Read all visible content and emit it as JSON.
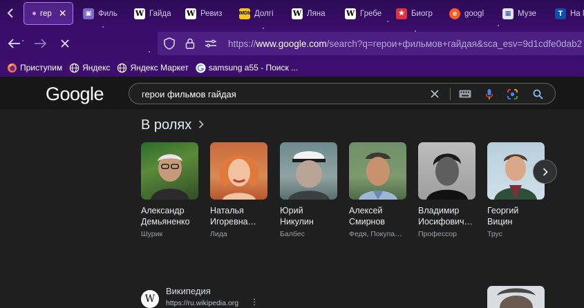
{
  "tabs": [
    {
      "label": "гер",
      "active": true,
      "favicon": "loading-dot-icon"
    },
    {
      "label": "Филь",
      "favicon": "film-icon"
    },
    {
      "label": "Гайда",
      "favicon": "wikipedia-icon"
    },
    {
      "label": "Ревиз",
      "favicon": "wikipedia-icon"
    },
    {
      "label": "Долгі",
      "favicon": "imdb-icon"
    },
    {
      "label": "Ляна",
      "favicon": "wikipedia-icon"
    },
    {
      "label": "Гребе",
      "favicon": "wikipedia-icon"
    },
    {
      "label": "Биогр",
      "favicon": "star-icon"
    },
    {
      "label": "googl",
      "favicon": "e-icon"
    },
    {
      "label": "Музе",
      "favicon": "museum-icon"
    },
    {
      "label": "На М",
      "favicon": "t-icon"
    }
  ],
  "tab_glyphs": {
    "wiki": "W",
    "film": "▣",
    "imdb": "IMDb",
    "star": "★",
    "e": "e",
    "museum": "▦",
    "t": "T"
  },
  "address_bar": {
    "url_prefix": "https://",
    "url_host": "www.google.com",
    "url_rest": "/search?q=герои+фильмов+гайдая&sca_esv=9d1cdfe0dab2"
  },
  "bookmarks": [
    {
      "label": "Приступим",
      "icon": "firefox-icon"
    },
    {
      "label": "Яндекс",
      "icon": "globe-icon"
    },
    {
      "label": "Яндекс Маркет",
      "icon": "globe-icon"
    },
    {
      "label": "samsung a55 - Поиск ...",
      "icon": "google-g-icon"
    }
  ],
  "google": {
    "logo": "Google",
    "query": "герои фильмов гайдая"
  },
  "cast_section": {
    "title": "В ролях",
    "cast": [
      {
        "name_line1": "Александр",
        "name_line2": "Демьяненко",
        "role": "Шурик"
      },
      {
        "name_line1": "Наталья",
        "name_line2": "Игоревна…",
        "role": "Лида"
      },
      {
        "name_line1": "Юрий",
        "name_line2": "Никулин",
        "role": "Балбес"
      },
      {
        "name_line1": "Алексей",
        "name_line2": "Смирнов",
        "role": "Федя, Покупа…"
      },
      {
        "name_line1": "Владимир",
        "name_line2": "Иосифович…",
        "role": "Профессор"
      },
      {
        "name_line1": "Георгий",
        "name_line2": "Вицин",
        "role": "Трус"
      }
    ]
  },
  "result": {
    "favicon_letter": "W",
    "site": "Википедия",
    "url": "https://ru.wikipedia.org",
    "more": "⋮"
  },
  "colors": {
    "chrome_purple": "#3a0d6b",
    "page_bg": "#1f1f1f",
    "header_bg": "#171717",
    "accent_tab": "#b07cff"
  }
}
